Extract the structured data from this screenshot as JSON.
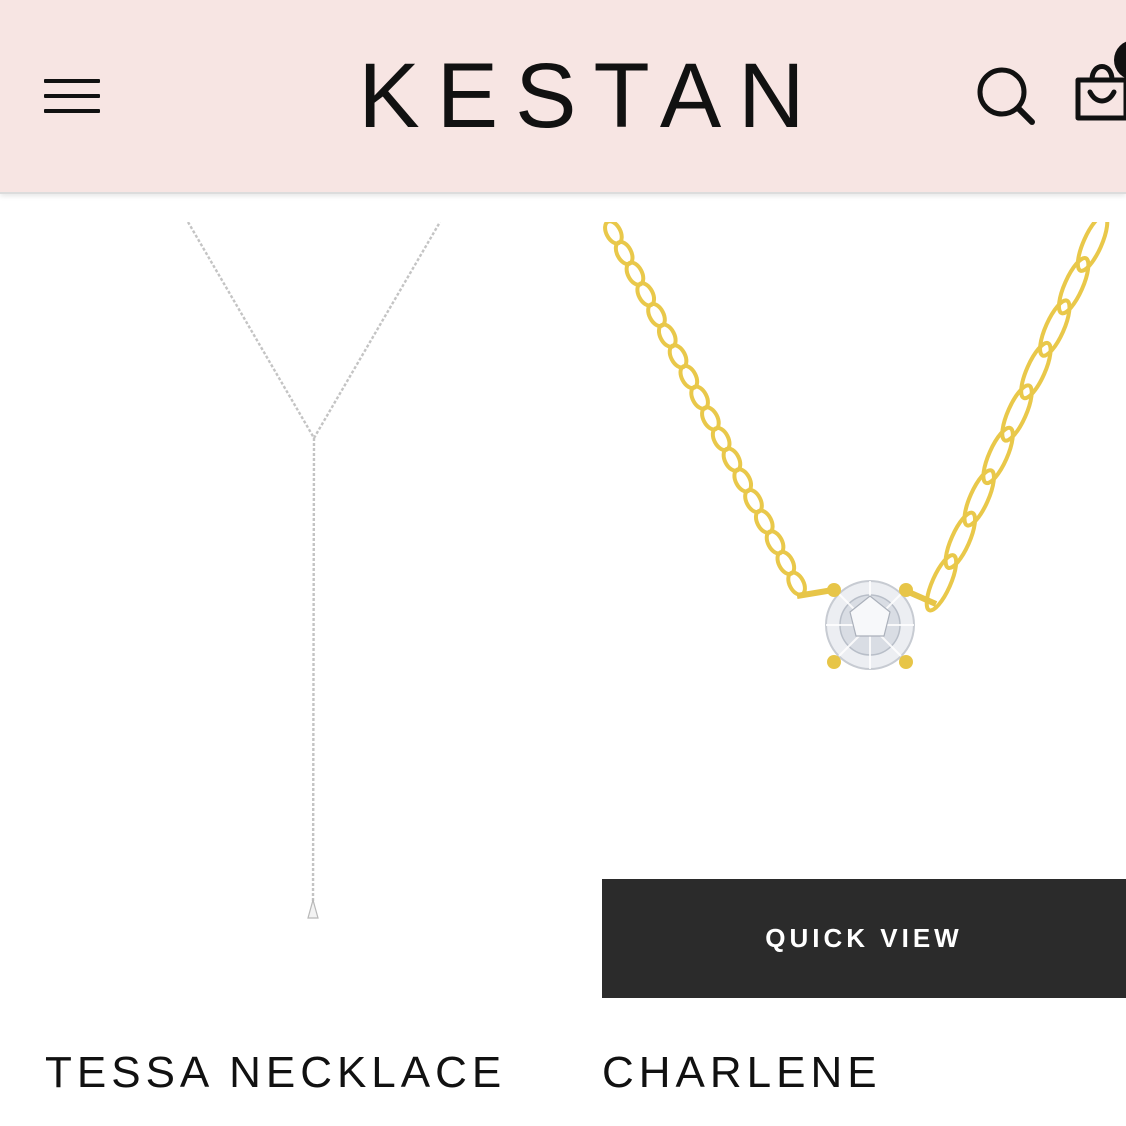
{
  "header": {
    "brand": "KESTAN",
    "icons": {
      "menu": "hamburger-menu-icon",
      "search": "search-icon",
      "cart": "shopping-bag-icon"
    },
    "background_color": "#f7e5e3"
  },
  "products": [
    {
      "name": "TESSA NECKLACE",
      "image": "silver-lariat-necklace"
    },
    {
      "name": "CHARLENE",
      "image": "gold-solitaire-chain-necklace",
      "quick_view_label": "QUICK VIEW"
    }
  ],
  "colors": {
    "button_bg": "#2b2b2b",
    "gold": "#e9c84a",
    "silver": "#bdbdbd"
  }
}
